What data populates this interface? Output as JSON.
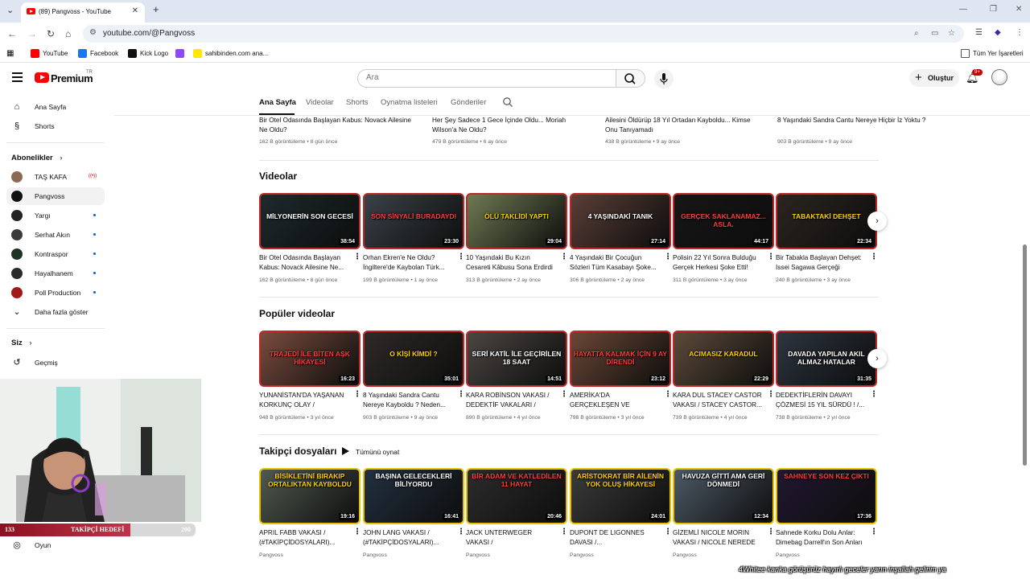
{
  "browser": {
    "tab_title": "(89) Pangvoss - YouTube",
    "url": "youtube.com/@Pangvoss",
    "bookmarks": [
      {
        "label": "YouTube",
        "color": "#ff0000"
      },
      {
        "label": "Facebook",
        "color": "#1877f2"
      },
      {
        "label": "Kick Logo",
        "color": "#111111"
      },
      {
        "label": "",
        "color": "#9146ff"
      },
      {
        "label": "sahibinden.com ana...",
        "color": "#ffe800"
      }
    ],
    "all_bookmarks_label": "Tüm Yer İşaretleri"
  },
  "youtube": {
    "logo_text": "Premium",
    "region": "TR",
    "search_placeholder": "Ara",
    "create_label": "Oluştur",
    "notifications_badge": "9+"
  },
  "sidebar": {
    "main": [
      {
        "label": "Ana Sayfa",
        "icon": "home-icon"
      },
      {
        "label": "Shorts",
        "icon": "shorts-icon"
      }
    ],
    "subscriptions_title": "Abonelikler",
    "subscriptions": [
      {
        "label": "TAŞ KAFA",
        "color": "#8a6a55",
        "live": true
      },
      {
        "label": "Pangvoss",
        "color": "#101010",
        "active": true
      },
      {
        "label": "Yargı",
        "color": "#222222",
        "dot": true
      },
      {
        "label": "Serhat Akın",
        "color": "#3a3a3a",
        "dot": true
      },
      {
        "label": "Kontraspor",
        "color": "#1f3324",
        "dot": true
      },
      {
        "label": "Hayalhanem",
        "color": "#2b2b2b",
        "dot": true
      },
      {
        "label": "Poll Production",
        "color": "#a01818",
        "dot": true
      }
    ],
    "show_more": "Daha fazla göster",
    "you_title": "Siz",
    "history": "Geçmiş",
    "game": "Oyun"
  },
  "channel_tabs": [
    "Ana Sayfa",
    "Videolar",
    "Shorts",
    "Oynatma listeleri",
    "Gönderiler"
  ],
  "top_row": [
    {
      "title": "Bir Otel Odasında Başlayan Kabus: Novack Ailesine Ne Oldu?",
      "views": "162 B görüntüleme",
      "age": "8 gün önce"
    },
    {
      "title": "Her Şey Sadece 1 Gece İçinde Oldu... Moriah Wilson'a Ne Oldu?",
      "views": "479 B görüntüleme",
      "age": "6 ay önce"
    },
    {
      "title": "Ailesini Öldürüp 18 Yıl Ortadan Kayboldu... Kimse Onu Tanıyamadı",
      "views": "438 B görüntüleme",
      "age": "9 ay önce"
    },
    {
      "title": "8 Yaşındaki Sandra Cantu Nereye Hiçbir İz Yoktu ?",
      "views": "903 B görüntüleme",
      "age": "9 ay önce"
    }
  ],
  "shelves": [
    {
      "title": "Videolar",
      "videos": [
        {
          "caption": "MİLYONERİN SON GECESİ",
          "duration": "38:54",
          "bg": "#1d2a2d",
          "title": "Bir Otel Odasında Başlayan Kabus: Novack Ailesine Ne...",
          "meta": "162 B görüntüleme • 8 gün önce"
        },
        {
          "caption": "SON SİNYALİ BURADAYDI",
          "duration": "23:30",
          "bg": "#3a4248",
          "title": "Orhan Ekren'e Ne Oldu? İngiltere'de Kaybolan Türk...",
          "meta": "199 B görüntüleme • 1 ay önce"
        },
        {
          "caption": "ÖLÜ TAKLİDİ YAPTI",
          "duration": "29:04",
          "bg": "#6f7a52",
          "title": "10 Yaşındaki Bu Kızın Cesareti Kâbusu Sona Erdirdi",
          "meta": "313 B görüntüleme • 2 ay önce"
        },
        {
          "caption": "4 YAŞINDAKİ TANIK",
          "duration": "27:14",
          "bg": "#5a3e36",
          "title": "4 Yaşındaki Bir Çocuğun Sözleri Tüm Kasabayı Şoke...",
          "meta": "306 B görüntüleme • 2 ay önce"
        },
        {
          "caption": "GERÇEK SAKLANAMAZ... ASLA.",
          "duration": "44:17",
          "bg": "#161616",
          "title": "Polisin 22 Yıl Sonra Bulduğu Gerçek Herkesi Şoke Etti!",
          "meta": "311 B görüntüleme • 3 ay önce"
        },
        {
          "caption": "TABAKTAKİ DEHŞET",
          "duration": "22:34",
          "bg": "#2b2520",
          "title": "Bir Tabakla Başlayan Dehşet: Issei Sagawa Gerçeği",
          "meta": "240 B görüntüleme • 3 ay önce"
        }
      ]
    },
    {
      "title": "Popüler videolar",
      "videos": [
        {
          "caption": "TRAJEDİ İLE BİTEN AŞK HİKAYESİ",
          "duration": "16:23",
          "bg": "#7a4c3e",
          "title": "YUNANİSTAN'DA YAŞANAN KORKUNÇ OLAY / DEDEKTİ...",
          "meta": "948 B görüntüleme • 3 yıl önce"
        },
        {
          "caption": "O KİŞİ KİMDİ ?",
          "duration": "35:01",
          "bg": "#2d2a28",
          "title": "8 Yaşındaki Sandra Cantu Nereye Kayboldu ? Neden...",
          "meta": "903 B görüntüleme • 9 ay önce"
        },
        {
          "caption": "SERİ KATİL İLE GEÇİRİLEN 18 SAAT",
          "duration": "14:51",
          "bg": "#4a4642",
          "title": "KARA ROBİNSON VAKASI / DEDEKTİF VAKALARI /",
          "meta": "890 B görüntüleme • 4 yıl önce"
        },
        {
          "caption": "HAYATTA KALMAK İÇİN 9 AY DİRENDİ",
          "duration": "23:12",
          "bg": "#6a4736",
          "title": "AMERİKA'DA GERÇEKLEŞEN VE FİLMLERİ ARATMAYAN...",
          "meta": "798 B görüntüleme • 3 yıl önce"
        },
        {
          "caption": "ACIMASIZ KARADUL",
          "duration": "22:29",
          "bg": "#5c4a3a",
          "title": "KARA DUL STACEY CASTOR VAKASI / STACEY CASTOR...",
          "meta": "739 B görüntüleme • 4 yıl önce"
        },
        {
          "caption": "DAVADA YAPILAN AKIL ALMAZ HATALAR",
          "duration": "31:35",
          "bg": "#2d3540",
          "title": "DEDEKTİFLERİN DAVAYI ÇÖZMESİ 15 YIL SÜRDÜ ! /...",
          "meta": "738 B görüntüleme • 2 yıl önce"
        }
      ]
    },
    {
      "title": "Takipçi dosyaları",
      "play_all": "Tümünü oynat",
      "videos": [
        {
          "caption": "BİSİKLETİNİ BIRAKIP ORTALIKTAN KAYBOLDU",
          "duration": "19:16",
          "bg": "#505a50",
          "title": "APRIL FABB VAKASI / (#TAKİPÇİDOSYALARI)...",
          "meta": "Pangvoss"
        },
        {
          "caption": "BAŞINA GELECEKLERİ BİLİYORDU",
          "duration": "16:41",
          "bg": "#223040",
          "title": "JOHN LANG VAKASI / (#TAKİPÇİDOSYALARI)...",
          "meta": "Pangvoss"
        },
        {
          "caption": "BİR ADAM VE KATLEDİLEN 11 HAYAT",
          "duration": "20:46",
          "bg": "#2c2c2c",
          "title": "JACK UNTERWEGER VAKASI / (#TAKİPÇİDOSYALARI)...",
          "meta": "Pangvoss"
        },
        {
          "caption": "ARİSTOKRAT BİR AİLENİN YOK OLUŞ HİKAYESİ",
          "duration": "24:01",
          "bg": "#3b3b3b",
          "title": "DUPONT DE LIGONNES DAVASI /...",
          "meta": "Pangvoss"
        },
        {
          "caption": "HAVUZA GİTTİ AMA GERİ DÖNMEDİ",
          "duration": "12:34",
          "bg": "#4d5a66",
          "title": "GİZEMLİ NICOLE MORIN VAKASI / NICOLE NEREDE ?...",
          "meta": "Pangvoss"
        },
        {
          "caption": "SAHNEYE SON KEZ ÇIKTI",
          "duration": "17:36",
          "bg": "#201830",
          "title": "Sahnede Korku Dolu Anlar: Dimebag Darrell'ın Son Anları",
          "meta": "Pangvoss"
        }
      ]
    }
  ],
  "overlay": {
    "follow_goal_label": "TAKİPÇİ HEDEFİ",
    "follow_current": "133",
    "follow_target": "200",
    "follow_fraction": 0.665,
    "ticker": "4Whitee kanka görüşürüz hayırlı geceler yarın inşallah gelirim ya"
  }
}
